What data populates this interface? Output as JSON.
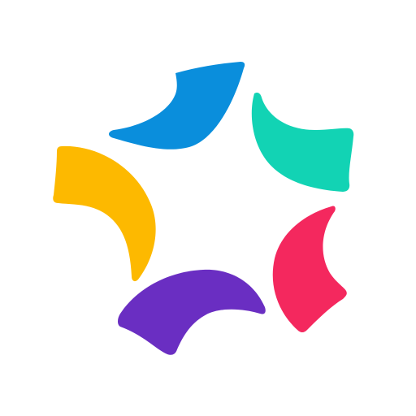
{
  "logo": {
    "name": "multicolor-star-logo",
    "petals": [
      {
        "name": "blue-petal",
        "color": "#0A8EDC"
      },
      {
        "name": "teal-petal",
        "color": "#12D3B4"
      },
      {
        "name": "red-petal",
        "color": "#F4285E"
      },
      {
        "name": "purple-petal",
        "color": "#6A2EC2"
      },
      {
        "name": "yellow-petal",
        "color": "#FDB900"
      }
    ]
  }
}
